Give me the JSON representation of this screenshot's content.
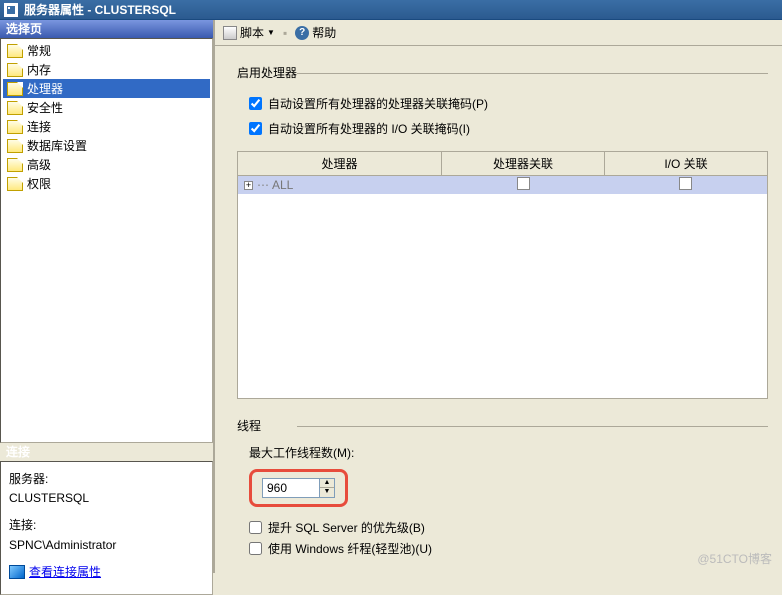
{
  "window": {
    "title": "服务器属性 - CLUSTERSQL"
  },
  "left": {
    "select_header": "选择页",
    "items": [
      "常规",
      "内存",
      "处理器",
      "安全性",
      "连接",
      "数据库设置",
      "高级",
      "权限"
    ],
    "selected_index": 2,
    "conn_header": "连接",
    "server_label": "服务器:",
    "server_value": "CLUSTERSQL",
    "conn_label": "连接:",
    "conn_value": "SPNC\\Administrator",
    "link_text": "查看连接属性"
  },
  "toolbar": {
    "script": "脚本",
    "help": "帮助"
  },
  "proc": {
    "group_label": "启用处理器",
    "cb1_label": "自动设置所有处理器的处理器关联掩码(P)",
    "cb1_checked": true,
    "cb2_label": "自动设置所有处理器的 I/O 关联掩码(I)",
    "cb2_checked": true,
    "grid": {
      "col_proc": "处理器",
      "col_aff": "处理器关联",
      "col_io": "I/O 关联",
      "row0_label": "ALL"
    }
  },
  "threads": {
    "group_label": "线程",
    "max_label": "最大工作线程数(M):",
    "max_value": "960",
    "cb_boost": "提升 SQL Server 的优先级(B)",
    "cb_boost_checked": false,
    "cb_fiber": "使用 Windows 纤程(轻型池)(U)",
    "cb_fiber_checked": false
  },
  "watermark": "@51CTO博客"
}
